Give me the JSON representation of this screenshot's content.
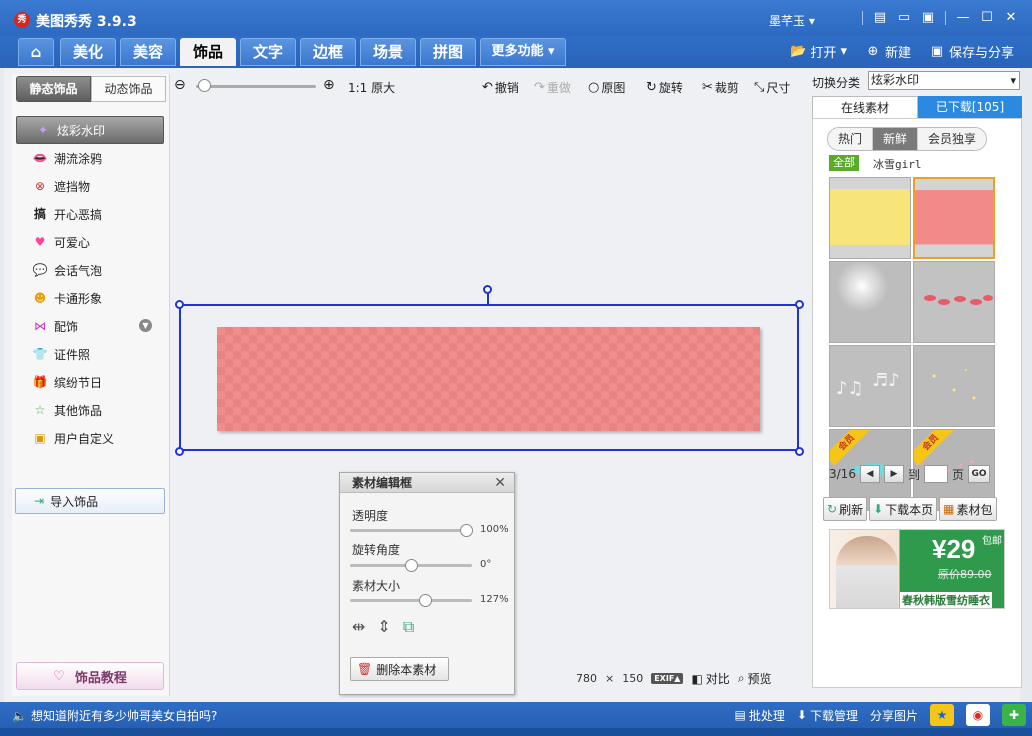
{
  "app": {
    "logo_text": "秀",
    "title": "美图秀秀 3.9.3",
    "user": "墨芊玉 ▾"
  },
  "tabs": [
    {
      "label": "美化"
    },
    {
      "label": "美容"
    },
    {
      "label": "饰品"
    },
    {
      "label": "文字"
    },
    {
      "label": "边框"
    },
    {
      "label": "场景"
    },
    {
      "label": "拼图"
    },
    {
      "label": "更多功能 ▾"
    }
  ],
  "file_actions": {
    "open": "打开",
    "new": "新建",
    "save": "保存与分享"
  },
  "left_panel": {
    "subtabs": [
      "静态饰品",
      "动态饰品"
    ],
    "categories": [
      {
        "label": "炫彩水印"
      },
      {
        "label": "潮流涂鸦"
      },
      {
        "label": "遮挡物"
      },
      {
        "label": "开心恶搞"
      },
      {
        "label": "可爱心"
      },
      {
        "label": "会话气泡"
      },
      {
        "label": "卡通形象"
      },
      {
        "label": "配饰"
      },
      {
        "label": "证件照"
      },
      {
        "label": "缤纷节日"
      },
      {
        "label": "其他饰品"
      },
      {
        "label": "用户自定义"
      }
    ],
    "import_label": "导入饰品",
    "tutorial_label": "饰品教程"
  },
  "canvas_toolbar": {
    "original_size": "1:1 原大",
    "undo": "撤销",
    "redo": "重做",
    "original": "原图",
    "rotate": "旋转",
    "crop": "裁剪",
    "size": "尺寸"
  },
  "edit_box": {
    "title": "素材编辑框",
    "opacity_label": "透明度",
    "opacity_value": "100%",
    "rotation_label": "旋转角度",
    "rotation_value": "0°",
    "scale_label": "素材大小",
    "scale_value": "127%",
    "delete_label": "删除本素材"
  },
  "canvas_status": {
    "width": "780",
    "times": "×",
    "height": "150",
    "exif": "EXIF▲",
    "compare": "对比",
    "preview": "预览"
  },
  "right_panel": {
    "switch_label": "切换分类",
    "switch_value": "炫彩水印",
    "tabs": [
      "在线素材",
      "已下载[105]"
    ],
    "filters": [
      "热门",
      "新鲜",
      "会员独享"
    ],
    "tag_all": "全部",
    "tag_other": "冰雪girl",
    "vip_label": "会员",
    "pager": {
      "current": "3/16",
      "to": "到",
      "page": "页",
      "go": "GO"
    },
    "actions": {
      "refresh": "刷新",
      "download_page": "下载本页",
      "package": "素材包"
    },
    "ad": {
      "price": "¥29",
      "baoyou": "包邮",
      "original": "原价89.00",
      "caption": "春秋韩版雪纺睡衣"
    }
  },
  "statusbar": {
    "tip": "想知道附近有多少帅哥美女自拍吗?",
    "batch": "批处理",
    "download_mgr": "下载管理",
    "share": "分享图片"
  }
}
